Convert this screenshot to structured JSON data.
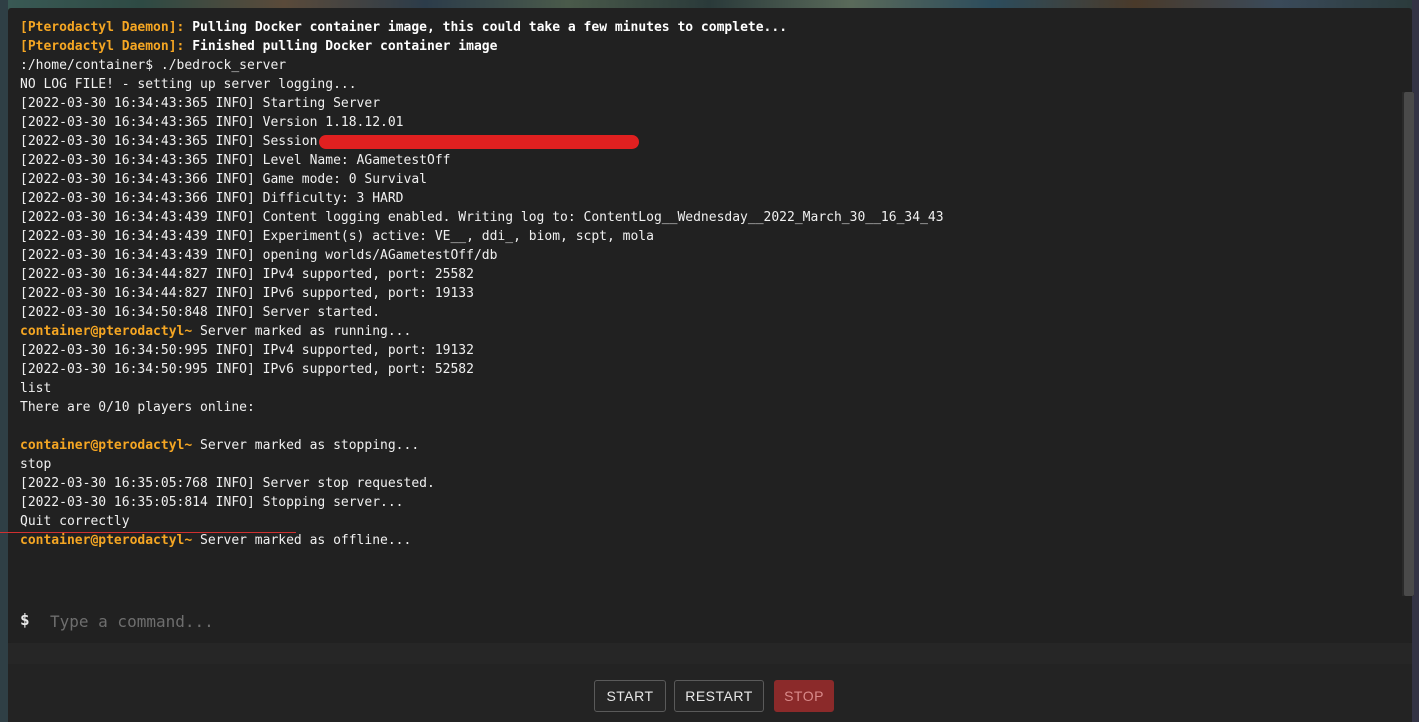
{
  "console": {
    "lines": [
      {
        "prefix": "[Pterodactyl Daemon]:",
        "text": " Pulling Docker container image, this could take a few minutes to complete..."
      },
      {
        "prefix": "[Pterodactyl Daemon]:",
        "text": " Finished pulling Docker container image"
      },
      {
        "text": ":/home/container$ ./bedrock_server"
      },
      {
        "text": "NO LOG FILE! - setting up server logging..."
      },
      {
        "text": "[2022-03-30 16:34:43:365 INFO] Starting Server"
      },
      {
        "text": "[2022-03-30 16:34:43:365 INFO] Version 1.18.12.01"
      },
      {
        "text": "[2022-03-30 16:34:43:365 INFO] Session"
      },
      {
        "text": "[2022-03-30 16:34:43:365 INFO] Level Name: AGametestOff"
      },
      {
        "text": "[2022-03-30 16:34:43:366 INFO] Game mode: 0 Survival"
      },
      {
        "text": "[2022-03-30 16:34:43:366 INFO] Difficulty: 3 HARD"
      },
      {
        "text": "[2022-03-30 16:34:43:439 INFO] Content logging enabled. Writing log to: ContentLog__Wednesday__2022_March_30__16_34_43"
      },
      {
        "text": "[2022-03-30 16:34:43:439 INFO] Experiment(s) active: VE__, ddi_, biom, scpt, mola"
      },
      {
        "text": "[2022-03-30 16:34:43:439 INFO] opening worlds/AGametestOff/db"
      },
      {
        "text": "[2022-03-30 16:34:44:827 INFO] IPv4 supported, port: 25582"
      },
      {
        "text": "[2022-03-30 16:34:44:827 INFO] IPv6 supported, port: 19133"
      },
      {
        "text": "[2022-03-30 16:34:50:848 INFO] Server started."
      },
      {
        "prefix": "container@pterodactyl~",
        "text": " Server marked as running..."
      },
      {
        "text": "[2022-03-30 16:34:50:995 INFO] IPv4 supported, port: 19132"
      },
      {
        "text": "[2022-03-30 16:34:50:995 INFO] IPv6 supported, port: 52582"
      },
      {
        "text": "list"
      },
      {
        "text": "There are 0/10 players online:"
      },
      {
        "text": ""
      },
      {
        "prefix": "container@pterodactyl~",
        "text": " Server marked as stopping..."
      },
      {
        "text": "stop"
      },
      {
        "text": "[2022-03-30 16:35:05:768 INFO] Server stop requested."
      },
      {
        "text": "[2022-03-30 16:35:05:814 INFO] Stopping server..."
      },
      {
        "text": "Quit correctly"
      },
      {
        "prefix": "container@pterodactyl~",
        "text": " Server marked as offline..."
      }
    ]
  },
  "command": {
    "prompt": "$",
    "placeholder": "Type a command..."
  },
  "controls": {
    "start_label": "START",
    "restart_label": "RESTART",
    "stop_label": "STOP"
  },
  "colors": {
    "prefix": "#f5a623",
    "redaction": "#e02020",
    "stop_button": "#8b2a2a"
  }
}
